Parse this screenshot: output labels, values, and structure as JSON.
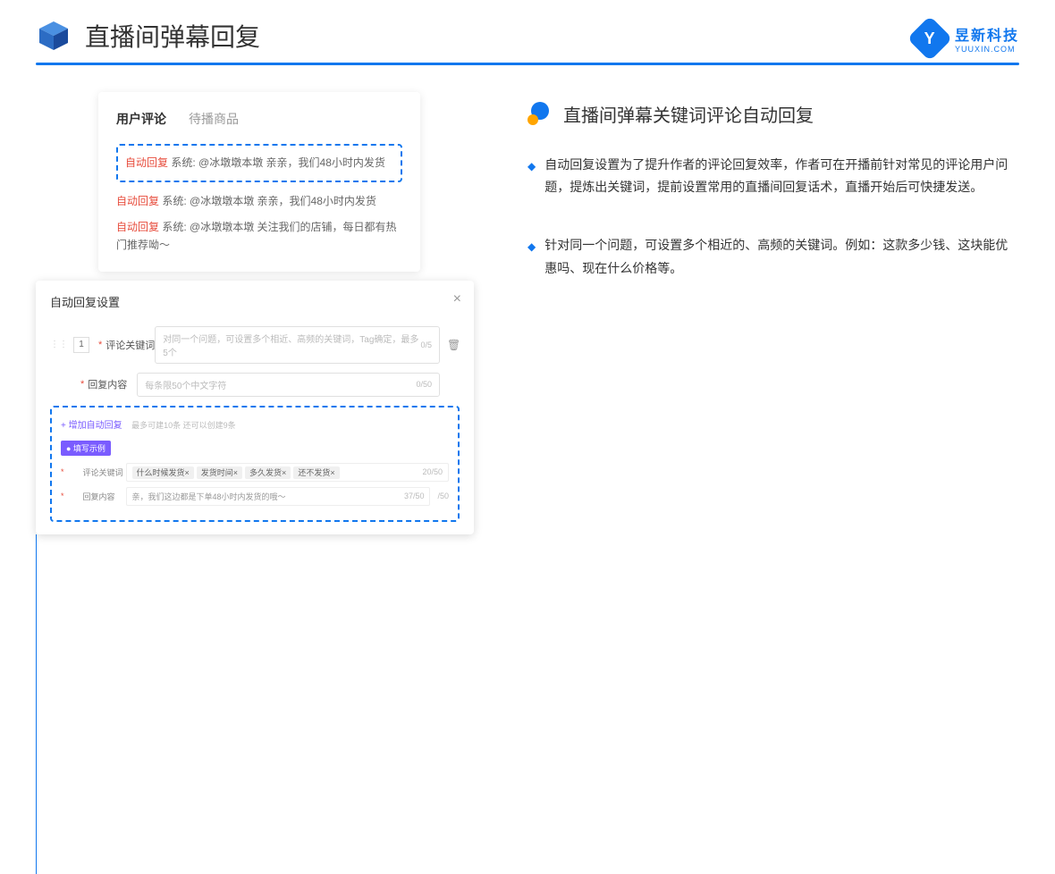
{
  "header": {
    "title": "直播间弹幕回复"
  },
  "logo": {
    "cn": "昱新科技",
    "en": "YUUXIN.COM",
    "mark": "Y"
  },
  "card1": {
    "tab_active": "用户评论",
    "tab_inactive": "待播商品",
    "hl_tag": "自动回复",
    "hl_text": " 系统: @冰墩墩本墩 亲亲，我们48小时内发货",
    "c2_tag": "自动回复",
    "c2_text": " 系统: @冰墩墩本墩 亲亲，我们48小时内发货",
    "c3_tag": "自动回复",
    "c3_text": " 系统: @冰墩墩本墩 关注我们的店铺，每日都有热门推荐呦～"
  },
  "card2": {
    "title": "自动回复设置",
    "num": "1",
    "label1": "评论关键词",
    "ph1": "对同一个问题，可设置多个相近、高频的关键词，Tag确定，最多5个",
    "count1": "0/5",
    "label2": "回复内容",
    "ph2": "每条限50个中文字符",
    "count2": "0/50",
    "add": "+ 增加自动回复",
    "add_hint": "最多可建10条 还可以创建9条",
    "example_tag": "● 填写示例",
    "ex_label1": "评论关键词",
    "tags": [
      "什么时候发货×",
      "发货时间×",
      "多久发货×",
      "还不发货×"
    ],
    "ex_count1": "20/50",
    "ex_label2": "回复内容",
    "ex_val2": "亲，我们这边都是下单48小时内发货的哦～",
    "ex_count2": "37/50",
    "side_count": "/50"
  },
  "right": {
    "section_title": "直播间弹幕关键词评论自动回复",
    "b1": "自动回复设置为了提升作者的评论回复效率，作者可在开播前针对常见的评论用户问题，提炼出关键词，提前设置常用的直播间回复话术，直播开始后可快捷发送。",
    "b2": "针对同一个问题，可设置多个相近的、高频的关键词。例如：这款多少钱、这块能优惠吗、现在什么价格等。"
  }
}
